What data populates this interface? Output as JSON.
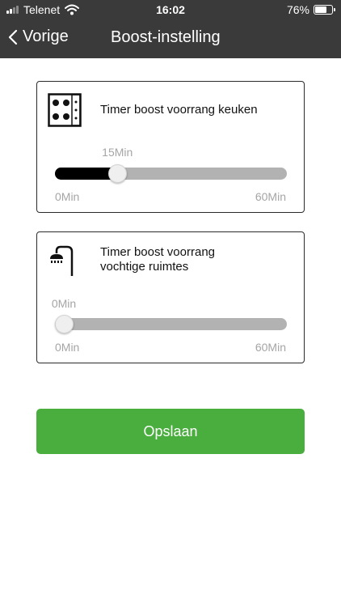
{
  "status_bar": {
    "carrier": "Telenet",
    "time": "16:02",
    "battery_percent": "76%",
    "battery_level": 0.76
  },
  "nav": {
    "back_label": "Vorige",
    "title": "Boost-instelling"
  },
  "kitchen": {
    "icon": "cooktop-icon",
    "title": "Timer boost voorrang keuken",
    "value_label": "15Min",
    "value": 15,
    "min": 0,
    "max": 60,
    "min_label": "0Min",
    "max_label": "60Min"
  },
  "wet_rooms": {
    "icon": "shower-icon",
    "title_line1": "Timer boost voorrang",
    "title_line2": "vochtige ruimtes",
    "value_label": "0Min",
    "value": 0,
    "min": 0,
    "max": 60,
    "min_label": "0Min",
    "max_label": "60Min"
  },
  "save_label": "Opslaan",
  "colors": {
    "header": "#3a3a3a",
    "save": "#49ae3e",
    "fill": "#000000",
    "track": "#b2b2b2"
  }
}
